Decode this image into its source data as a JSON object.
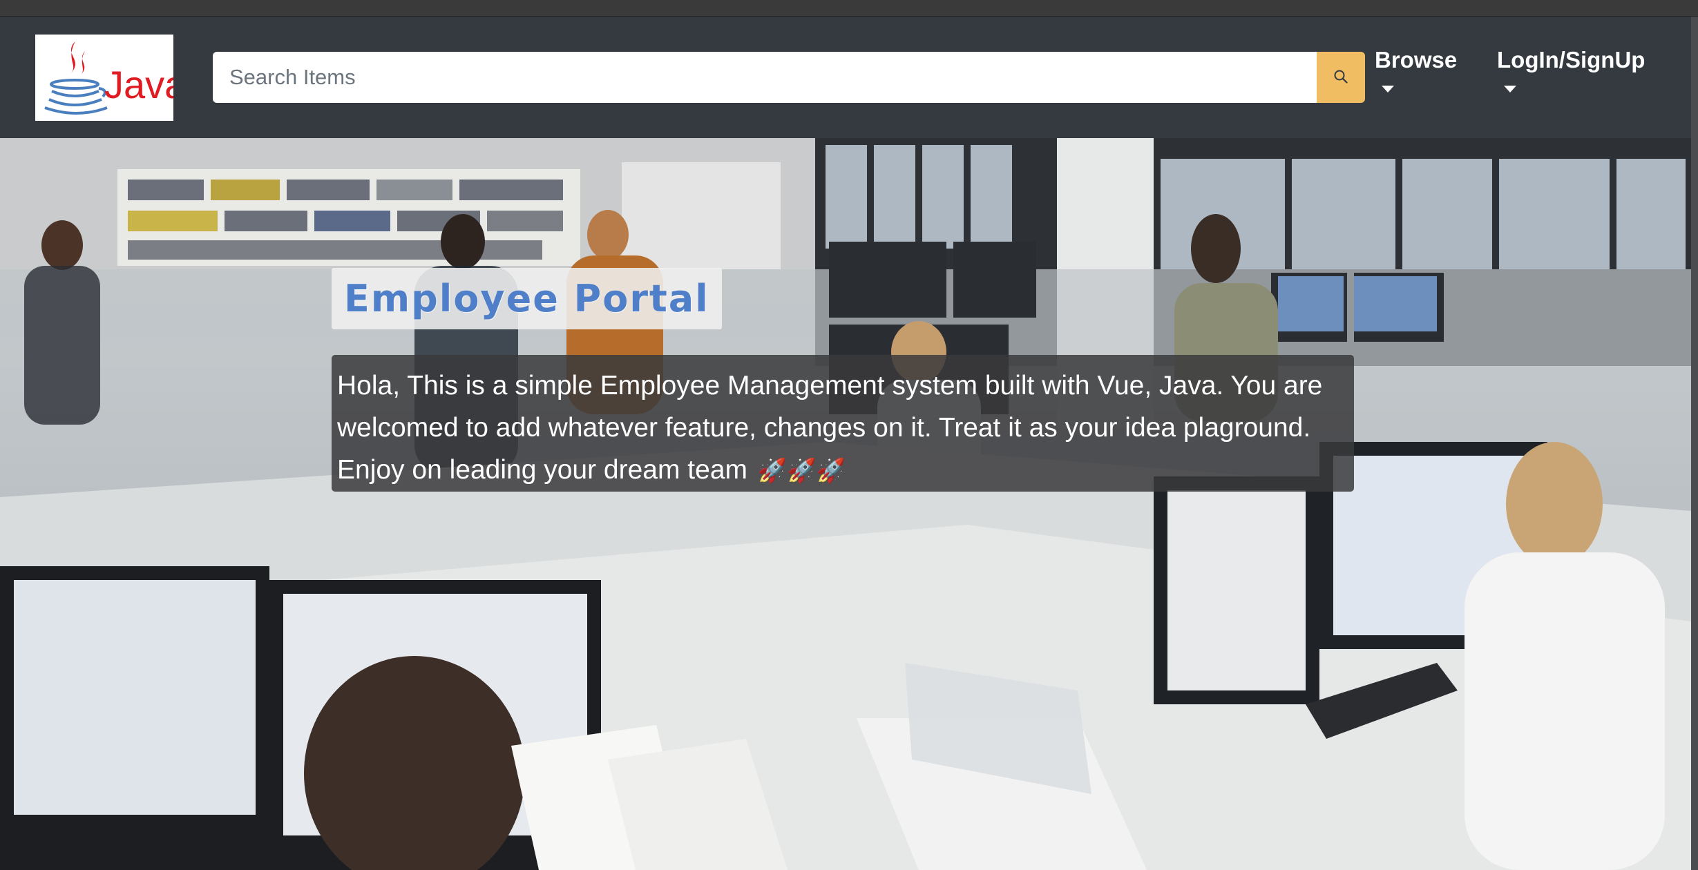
{
  "navbar": {
    "logo_text": "Java",
    "search": {
      "placeholder": "Search Items",
      "value": ""
    },
    "menu": {
      "browse_label": "Browse",
      "login_label": "LogIn/SignUp"
    }
  },
  "hero": {
    "title": "Employee Portal",
    "description": "Hola, This is a simple Employee Management system built with Vue, Java. You are welcomed to add whatever feature, changes on it. Treat it as your idea plaground. Enjoy on leading your dream team",
    "emoji": "🚀🚀🚀"
  },
  "colors": {
    "navbar_bg": "#343a40",
    "search_button": "#f0bd62",
    "title_color": "#4f7fc9",
    "java_red": "#e01b22",
    "java_blue": "#4a7fbf"
  },
  "icons": {
    "search": "search-icon",
    "browse_caret": "caret-down-icon",
    "login_caret": "caret-down-icon",
    "logo": "java-logo-icon"
  }
}
